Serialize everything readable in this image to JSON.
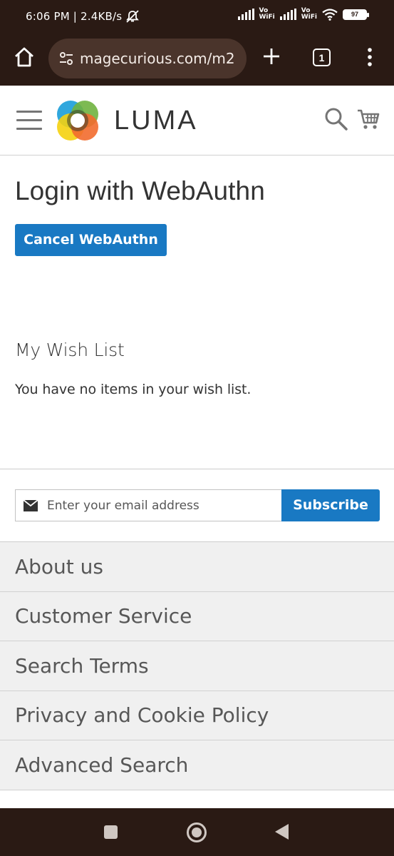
{
  "status_bar": {
    "time_and_speed": "6:06 PM | 2.4KB/s",
    "vowifi_1": "Vo\nWiFi",
    "vowifi_2": "Vo\nWiFi",
    "battery": "97"
  },
  "browser": {
    "url": "magecurious.com/m2",
    "tab_count": "1"
  },
  "header": {
    "logo_text": "LUMA"
  },
  "main": {
    "page_title": "Login with WebAuthn",
    "cancel_button": "Cancel WebAuthn",
    "wishlist_title": "My Wish List",
    "wishlist_empty": "You have no items in your wish list."
  },
  "newsletter": {
    "placeholder": "Enter your email address",
    "subscribe_label": "Subscribe"
  },
  "footer": {
    "links": [
      "About us",
      "Customer Service",
      "Search Terms",
      "Privacy and Cookie Policy",
      "Advanced Search"
    ]
  },
  "colors": {
    "primary": "#1979c3",
    "system_bar": "#2a1a14",
    "url_bar": "#4a342b"
  }
}
